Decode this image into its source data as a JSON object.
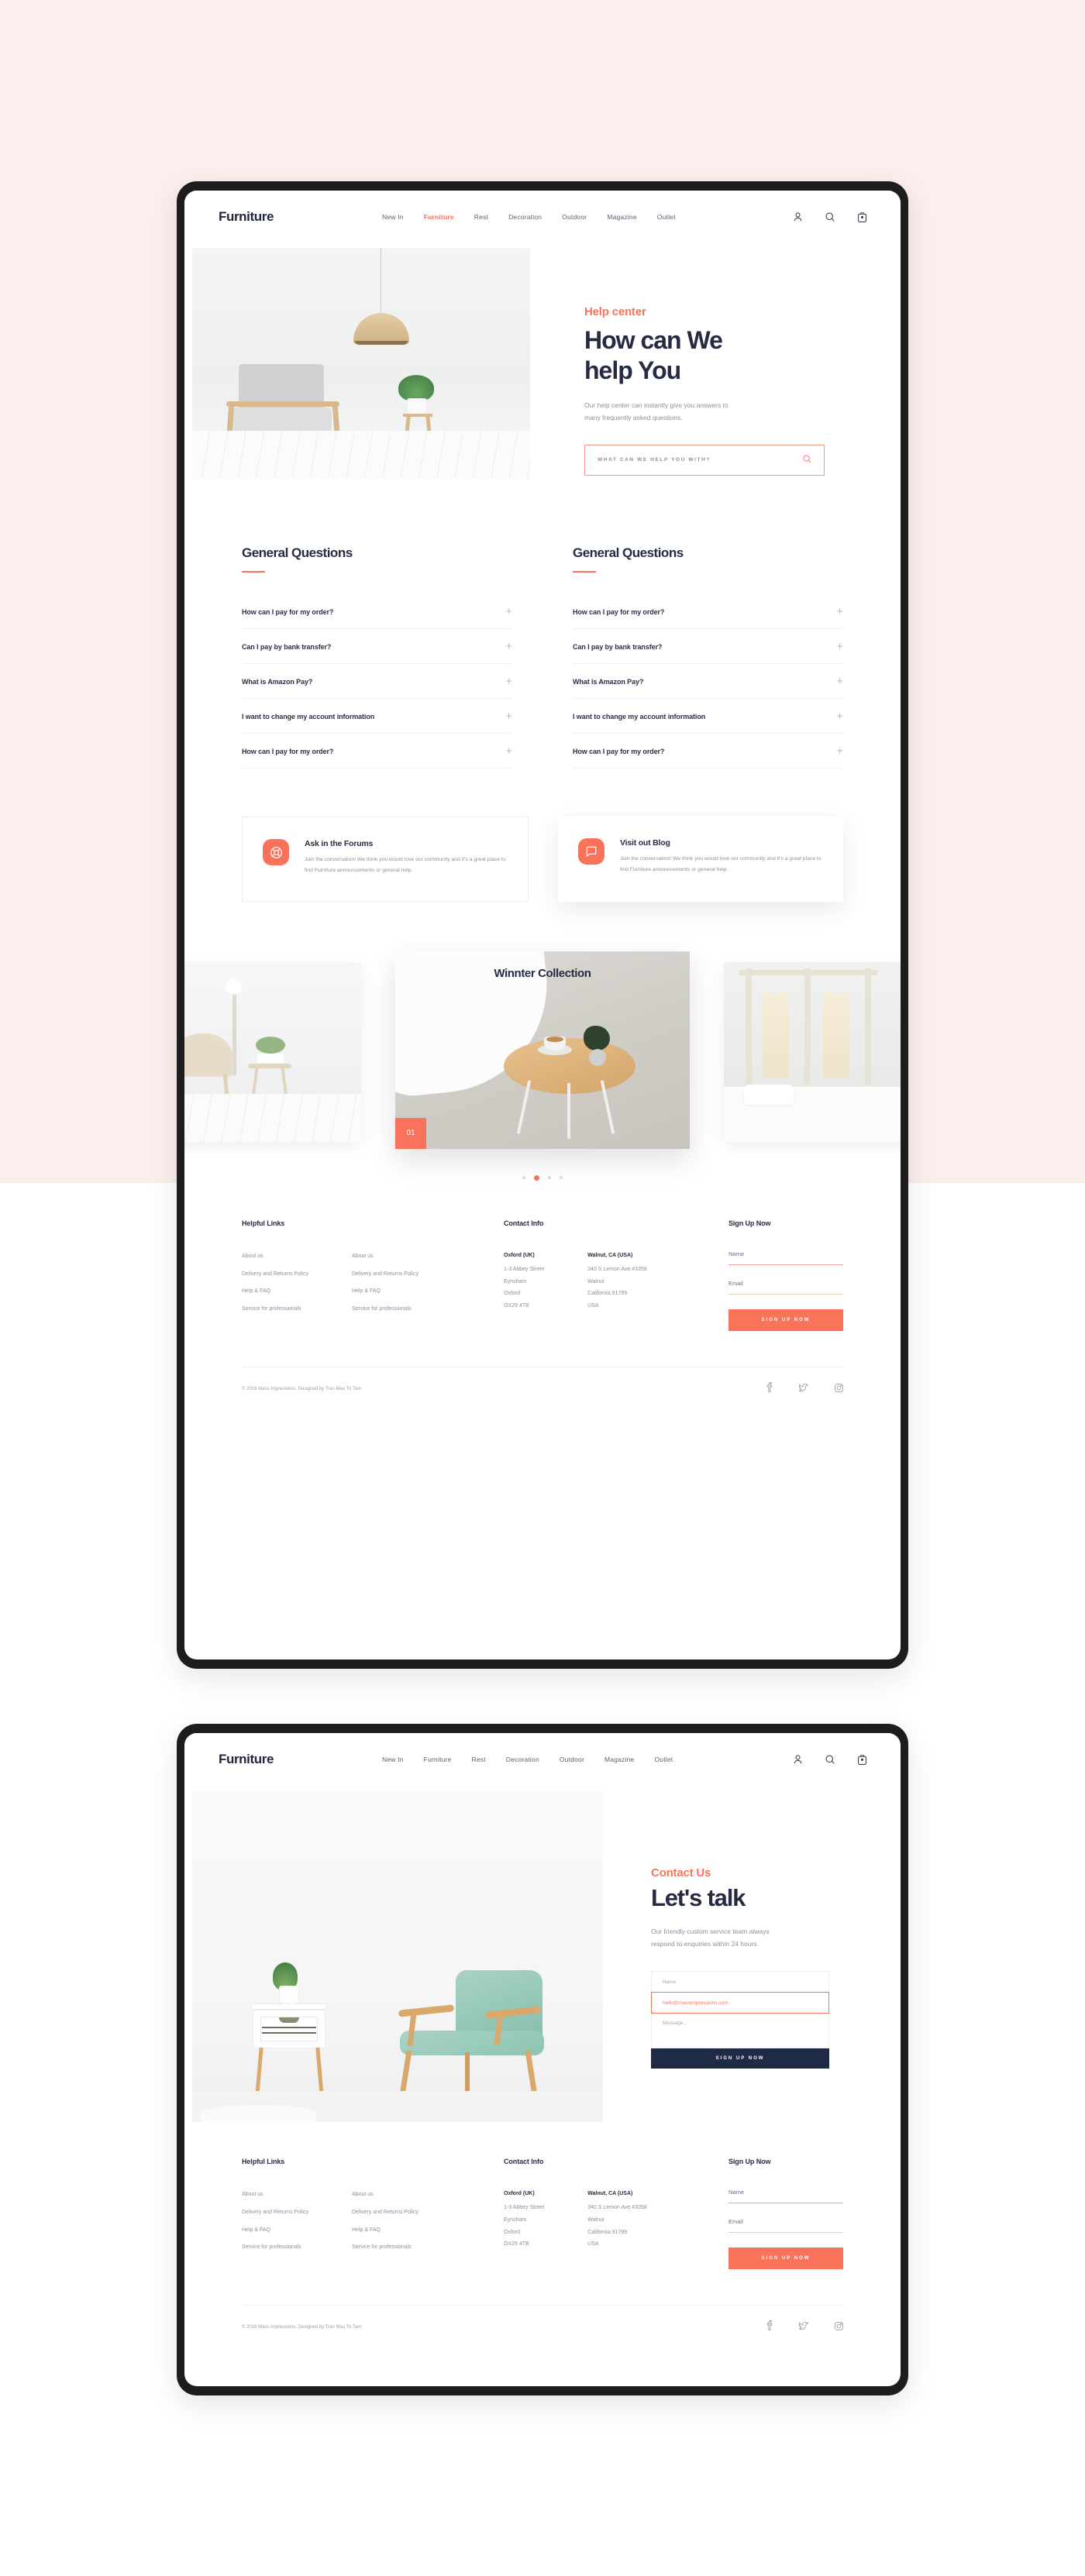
{
  "brand": "Furniture",
  "nav": {
    "links": [
      {
        "label": "New In",
        "active": false
      },
      {
        "label": "Furniture",
        "active": true
      },
      {
        "label": "Rest",
        "active": false
      },
      {
        "label": "Decoration",
        "active": false
      },
      {
        "label": "Outdoor",
        "active": false
      },
      {
        "label": "Magazine",
        "active": false
      },
      {
        "label": "Outlet",
        "active": false
      }
    ],
    "icons": [
      "user-icon",
      "search-icon",
      "bag-icon"
    ]
  },
  "nav2": {
    "links": [
      {
        "label": "New In",
        "active": false
      },
      {
        "label": "Furniture",
        "active": false
      },
      {
        "label": "Rest",
        "active": false
      },
      {
        "label": "Decoration",
        "active": false
      },
      {
        "label": "Outdoor",
        "active": false
      },
      {
        "label": "Magazine",
        "active": false
      },
      {
        "label": "Outlet",
        "active": false
      }
    ]
  },
  "hero": {
    "eyebrow": "Help center",
    "title_line1": "How can We",
    "title_line2": "help You",
    "subtitle_line1": "Our help center can instantly give you answers to",
    "subtitle_line2": "many frequently asked questions.",
    "search_placeholder": "WHAT CAN WE HELP YOU WITH?"
  },
  "faq": {
    "left": {
      "heading": "General Questions",
      "items": [
        "How can I pay for my order?",
        "Can I pay by bank transfer?",
        "What is Amazon Pay?",
        "I want to change my account information",
        "How can I pay for my order?"
      ]
    },
    "right": {
      "heading": "General Questions",
      "items": [
        "How can I pay for my order?",
        "Can I pay by bank transfer?",
        "What is Amazon Pay?",
        "I want to change my account information",
        "How can I pay for my order?"
      ]
    },
    "expand_glyph": "+"
  },
  "help_cards": [
    {
      "icon": "lifebuoy-icon",
      "title": "Ask in the Forums",
      "text": "Join the conversation! We think you would love our community and it's a great place to find Furniture announcements or general help."
    },
    {
      "icon": "chat-bubble-icon",
      "title": "Visit out Blog",
      "text": "Join the conversation! We think you would love our community and it's a great place to find Furniture announcements or general help."
    }
  ],
  "carousel": {
    "title": "Winnter Collection",
    "badge": "01",
    "dots": 4,
    "active_dot": 1
  },
  "footer": {
    "helpful": {
      "heading": "Helpful Links",
      "col1": [
        "About us",
        "Delivery and Returns Policy",
        "Help & FAQ",
        "Service for professionals"
      ],
      "col2": [
        "About us",
        "Delivery and Returns Policy",
        "Help & FAQ",
        "Service for professionals"
      ]
    },
    "contact": {
      "heading": "Contact Info",
      "addr1_title": "Oxford (UK)",
      "addr1": [
        "1-3 Abbey Street",
        "Eynsham",
        "Oxford",
        "OX29 4TB"
      ],
      "addr2_title": "Walnut, CA (USA)",
      "addr2": [
        "340 S Lemon Ave #3358",
        "Walnut",
        "California 91789",
        "USA"
      ]
    },
    "signup": {
      "heading": "Sign Up Now",
      "name_label": "Name",
      "email_label": "Email",
      "button": "SIGN UP NOW"
    },
    "copyright": "© 2018 Mass Impressions. Designed by Tran Mau Tri Tam",
    "socials": [
      "facebook-icon",
      "twitter-icon",
      "instagram-icon"
    ]
  },
  "contact_page": {
    "eyebrow": "Contact Us",
    "title": "Let's talk",
    "subtitle_line1": "Our friendly custom service team always",
    "subtitle_line2": "respond to enquiries within 24 hours.",
    "name_placeholder": "Name",
    "email_value": "hello@massimpressions.com",
    "message_placeholder": "Message...",
    "button": "SIGN UP NOW"
  },
  "colors": {
    "accent": "#f9735b",
    "ink": "#262b43",
    "muted": "#8b8f9e",
    "dark_button": "#1f2a44",
    "page_background": "#fceeec"
  }
}
